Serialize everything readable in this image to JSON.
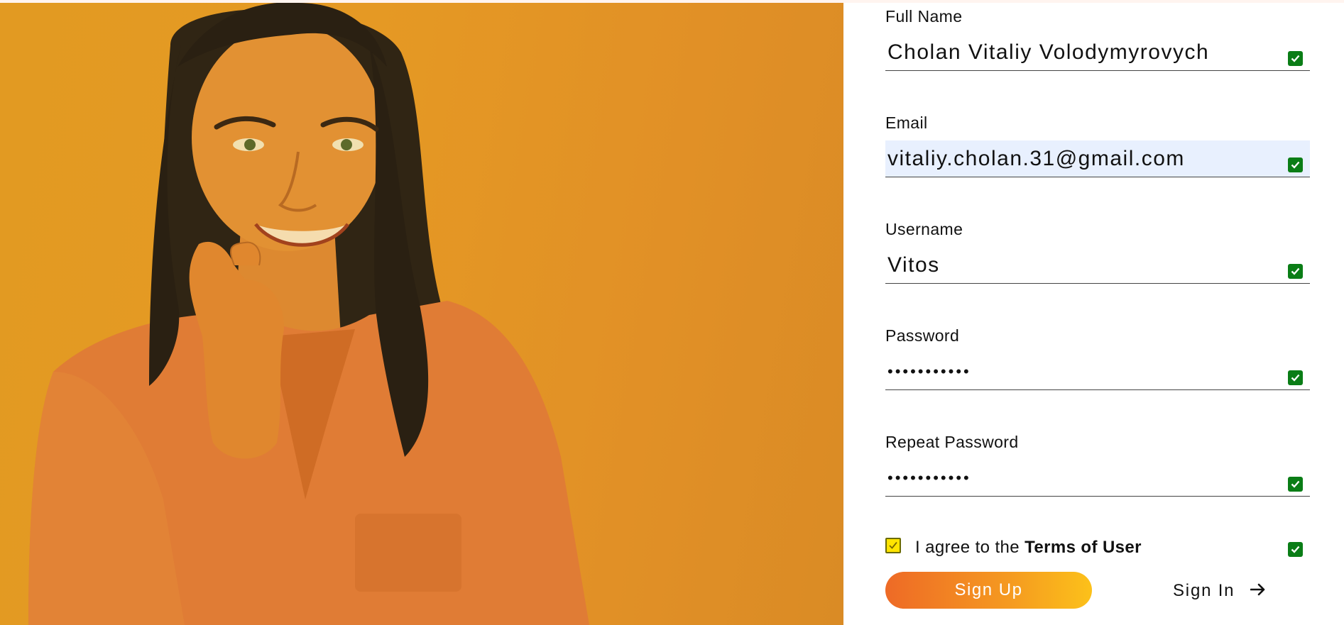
{
  "form": {
    "fields": [
      {
        "label": "Full Name",
        "value": "Cholan Vitaliy Volodymyrovych"
      },
      {
        "label": "Email",
        "value": "vitaliy.cholan.31@gmail.com"
      },
      {
        "label": "Username",
        "value": "Vitos"
      },
      {
        "label": "Password",
        "value": "•••••••••••"
      },
      {
        "label": "Repeat Password",
        "value": "•••••••••••"
      }
    ],
    "agree": {
      "prefix": "I agree to the ",
      "terms_link": "Terms of User",
      "checked": true
    },
    "signup_label": "Sign Up",
    "signin_label": "Sign In"
  },
  "colors": {
    "accent_orange": "#ee6a26",
    "accent_yellow": "#fcc11a",
    "hero_tint": "#e59924",
    "valid_green": "#0a7d16",
    "autofill_blue": "#e8f0fe"
  },
  "icons": {
    "valid": "check-square-icon",
    "agree": "checkbox-checked-icon",
    "signin": "arrow-right-icon"
  }
}
